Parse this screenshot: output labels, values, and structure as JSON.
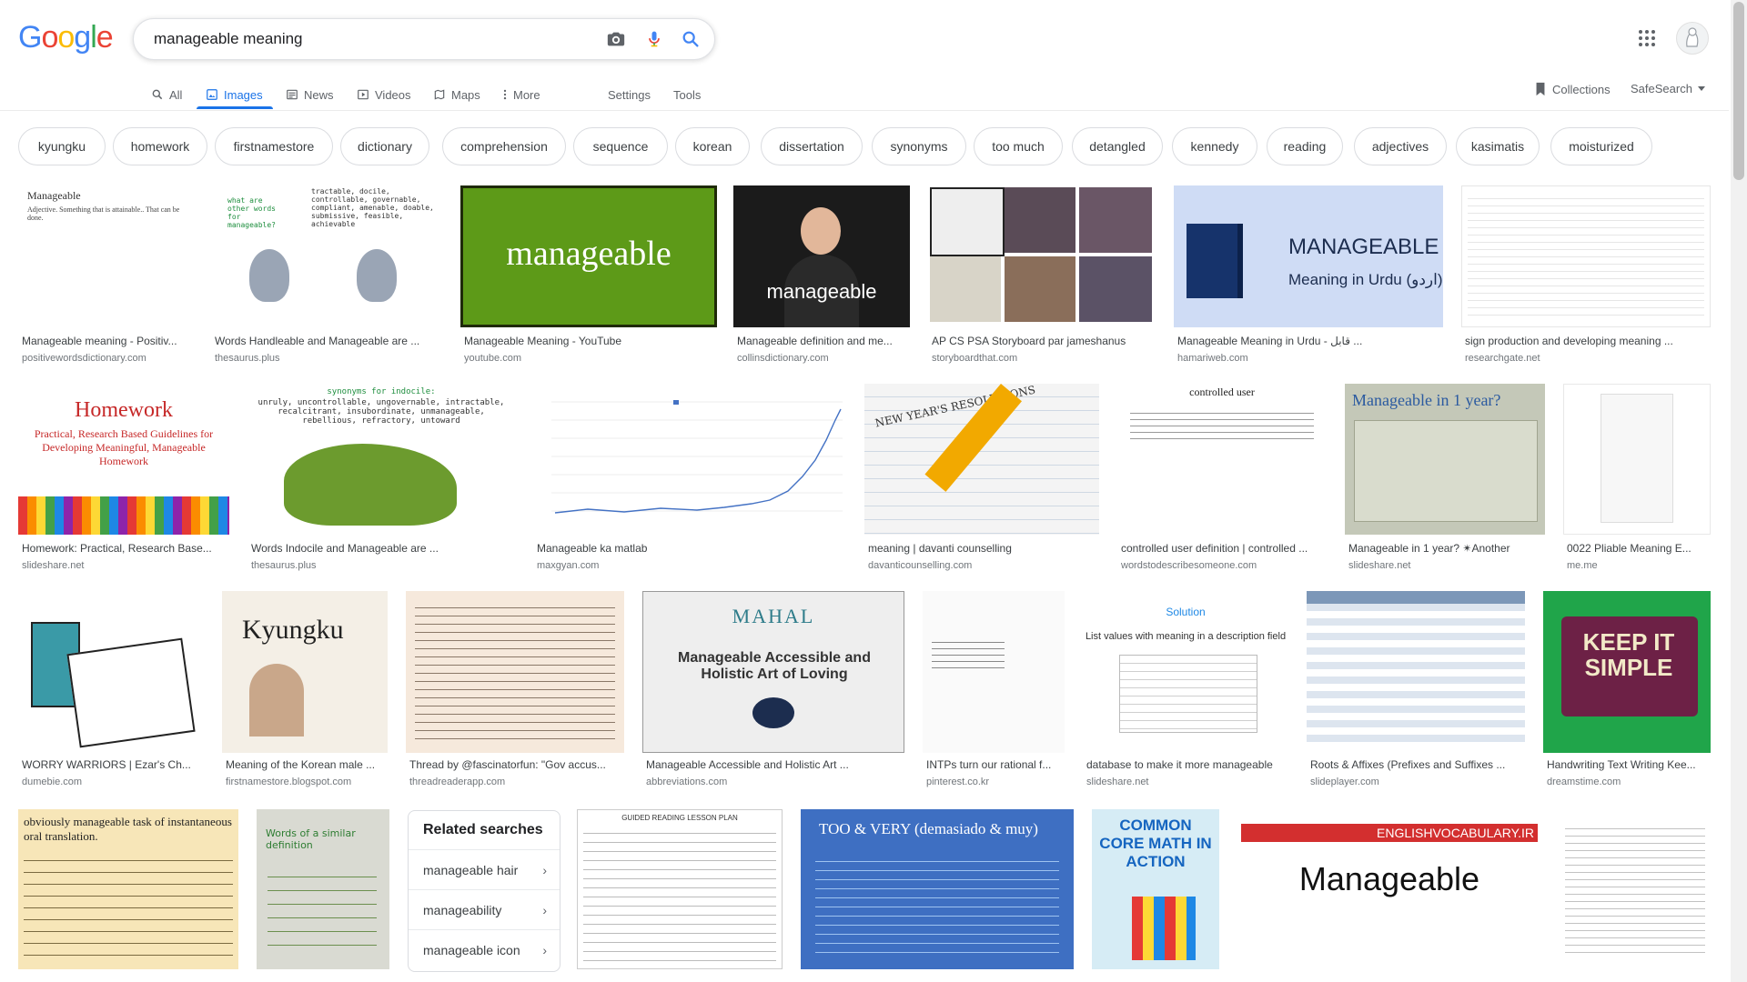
{
  "logo": {
    "letters": [
      "G",
      "o",
      "o",
      "g",
      "l",
      "e"
    ],
    "colors": [
      "#4285f4",
      "#ea4335",
      "#fbbc05",
      "#4285f4",
      "#34a853",
      "#ea4335"
    ]
  },
  "search": {
    "value": "manageable meaning"
  },
  "tabs": [
    {
      "label": "All",
      "icon": "search-icon"
    },
    {
      "label": "Images",
      "icon": "image-icon",
      "active": true
    },
    {
      "label": "News",
      "icon": "news-icon"
    },
    {
      "label": "Videos",
      "icon": "video-icon"
    },
    {
      "label": "Maps",
      "icon": "map-icon"
    },
    {
      "label": "More",
      "icon": "more-vertical-icon"
    },
    {
      "label": "Settings"
    },
    {
      "label": "Tools"
    }
  ],
  "right_links": {
    "collections": "Collections",
    "safesearch": "SafeSearch"
  },
  "chips": [
    "kyungku",
    "homework",
    "firstnamestore",
    "dictionary",
    "comprehension",
    "sequence",
    "korean",
    "dissertation",
    "synonyms",
    "too much",
    "detangled",
    "kennedy",
    "reading",
    "adjectives",
    "kasimatis",
    "moisturized"
  ],
  "row1": [
    {
      "title": "Manageable meaning - Positiv...",
      "source": "positivewordsdictionary.com",
      "thumb_text": "Manageable",
      "thumb_sub": "Adjective. Something that is attainable.. That can be done."
    },
    {
      "title": "Words Handleable and Manageable are ...",
      "source": "thesaurus.plus",
      "thumb_text": "tractable, docile, controllable, governable, compliant, amenable, doable, submissive, feasible, achievable",
      "thumb_sub": "what are other words for manageable?"
    },
    {
      "title": "Manageable Meaning - YouTube",
      "source": "youtube.com",
      "thumb_text": "manageable"
    },
    {
      "title": "Manageable definition and me...",
      "source": "collinsdictionary.com",
      "thumb_text": "manageable"
    },
    {
      "title": "AP CS PSA Storyboard par jameshanus",
      "source": "storyboardthat.com"
    },
    {
      "title": "Manageable Meaning in Urdu - قابل ...",
      "source": "hamariweb.com",
      "thumb_text": "MANAGEABLE",
      "thumb_sub": "Meaning in Urdu (اردو)"
    },
    {
      "title": "sign production and developing meaning ...",
      "source": "researchgate.net"
    }
  ],
  "row2": [
    {
      "title": "Homework: Practical, Research Base...",
      "source": "slideshare.net",
      "thumb_text": "Homework",
      "thumb_sub": "Practical, Research Based Guidelines for Developing Meaningful, Manageable Homework"
    },
    {
      "title": "Words Indocile and Manageable are ...",
      "source": "thesaurus.plus",
      "thumb_text": "synonyms for indocile:",
      "thumb_sub": "unruly, uncontrollable, ungovernable, intractable, recalcitrant, insubordinate, unmanageable, rebellious, refractory, untoward"
    },
    {
      "title": "Manageable ka matlab",
      "source": "maxgyan.com"
    },
    {
      "title": "meaning | davanti counselling",
      "source": "davanticounselling.com",
      "thumb_text": "NEW YEAR'S RESOLUTIONS"
    },
    {
      "title": "controlled user definition | controlled ...",
      "source": "wordstodescribesomeone.com",
      "thumb_text": "controlled user"
    },
    {
      "title": "Manageable in 1 year? ✴Another",
      "source": "slideshare.net",
      "thumb_text": "Manageable in 1 year?"
    },
    {
      "title": "0022 Pliable Meaning E...",
      "source": "me.me"
    }
  ],
  "row3": [
    {
      "title": "WORRY WARRIORS | Ezar's Ch...",
      "source": "dumebie.com"
    },
    {
      "title": "Meaning of the Korean male ...",
      "source": "firstnamestore.blogspot.com",
      "thumb_text": "Kyungku"
    },
    {
      "title": "Thread by @fascinatorfun: \"Gov accus...",
      "source": "threadreaderapp.com"
    },
    {
      "title": "Manageable Accessible and Holistic Art ...",
      "source": "abbreviations.com",
      "thumb_text": "MAHAL",
      "thumb_sub": "Manageable Accessible and Holistic Art of Loving"
    },
    {
      "title": "INTPs turn our rational f...",
      "source": "pinterest.co.kr"
    },
    {
      "title": "database to make it more manageable",
      "source": "slideshare.net",
      "thumb_text": "Solution",
      "thumb_sub": "List values with meaning in a description field"
    },
    {
      "title": "Roots & Affixes (Prefixes and Suffixes ...",
      "source": "slideplayer.com"
    },
    {
      "title": "Handwriting Text Writing Kee...",
      "source": "dreamstime.com",
      "thumb_text": "KEEP IT SIMPLE"
    }
  ],
  "row4": [
    {
      "thumb_text": "obviously manageable task of instantaneous oral translation."
    },
    {
      "thumb_text": "Words of a similar definition"
    },
    {
      "thumb_text": "GUIDED READING LESSON PLAN"
    },
    {
      "thumb_text": "TOO & VERY (demasiado & muy)"
    },
    {
      "thumb_text": "COMMON CORE MATH IN ACTION"
    },
    {
      "thumb_text": "Manageable",
      "thumb_sub": "ENGLISHVOCABULARY.IR"
    },
    {}
  ],
  "related": {
    "heading": "Related searches",
    "items": [
      "manageable hair",
      "manageability",
      "manageable icon"
    ]
  }
}
